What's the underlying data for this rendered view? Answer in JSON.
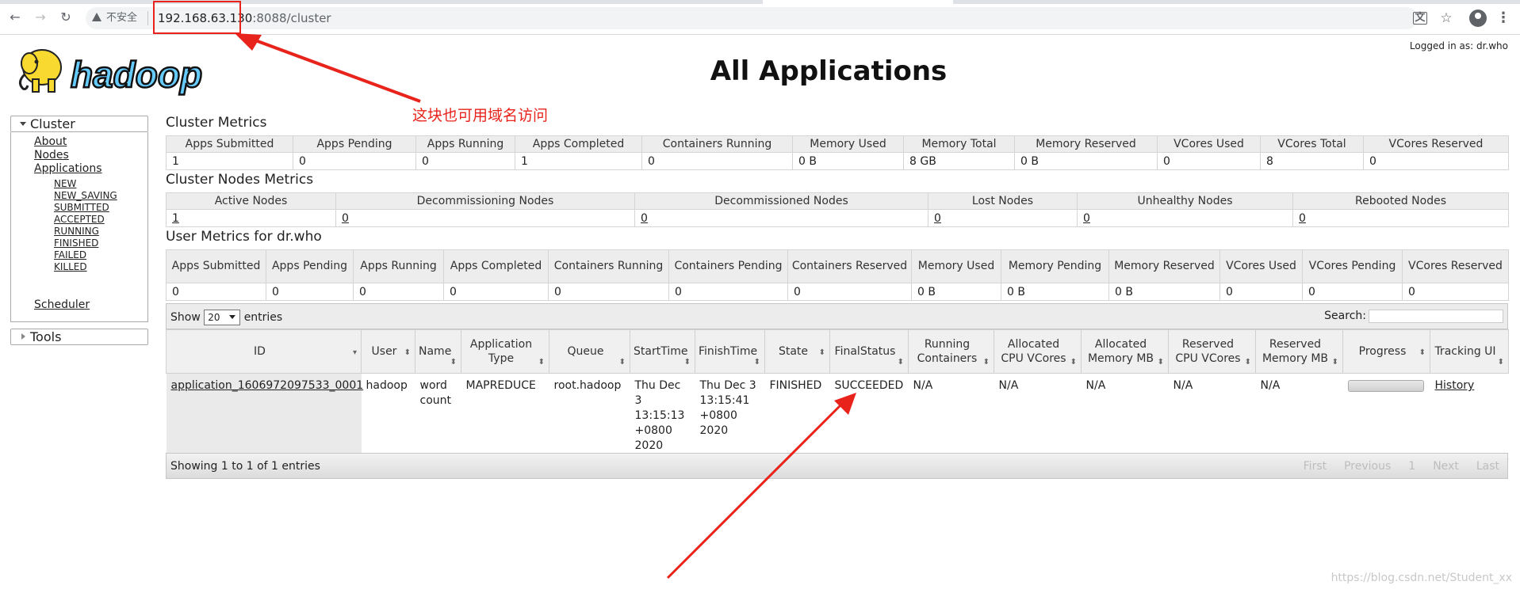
{
  "browser": {
    "security_label": "不安全",
    "url_host": "192.168.63.130",
    "url_rest": ":8088/cluster"
  },
  "header": {
    "logged_in": "Logged in as: dr.who",
    "title": "All Applications",
    "logo_text": "hadoop"
  },
  "annotation": "这块也可用域名访问",
  "nav": {
    "cluster_label": "Cluster",
    "about": "About",
    "nodes": "Nodes",
    "applications": "Applications",
    "app_states": [
      "NEW",
      "NEW_SAVING",
      "SUBMITTED",
      "ACCEPTED",
      "RUNNING",
      "FINISHED",
      "FAILED",
      "KILLED"
    ],
    "scheduler": "Scheduler",
    "tools_label": "Tools"
  },
  "cluster_metrics": {
    "title": "Cluster Metrics",
    "headers": [
      "Apps Submitted",
      "Apps Pending",
      "Apps Running",
      "Apps Completed",
      "Containers Running",
      "Memory Used",
      "Memory Total",
      "Memory Reserved",
      "VCores Used",
      "VCores Total",
      "VCores Reserved"
    ],
    "values": [
      "1",
      "0",
      "0",
      "1",
      "0",
      "0 B",
      "8 GB",
      "0 B",
      "0",
      "8",
      "0"
    ]
  },
  "node_metrics": {
    "title": "Cluster Nodes Metrics",
    "headers": [
      "Active Nodes",
      "Decommissioning Nodes",
      "Decommissioned Nodes",
      "Lost Nodes",
      "Unhealthy Nodes",
      "Rebooted Nodes"
    ],
    "values": [
      "1",
      "0",
      "0",
      "0",
      "0",
      "0"
    ]
  },
  "user_metrics": {
    "title": "User Metrics for dr.who",
    "headers": [
      "Apps Submitted",
      "Apps Pending",
      "Apps Running",
      "Apps Completed",
      "Containers Running",
      "Containers Pending",
      "Containers Reserved",
      "Memory Used",
      "Memory Pending",
      "Memory Reserved",
      "VCores Used",
      "VCores Pending",
      "VCores Reserved"
    ],
    "values": [
      "0",
      "0",
      "0",
      "0",
      "0",
      "0",
      "0",
      "0 B",
      "0 B",
      "0 B",
      "0",
      "0",
      "0"
    ]
  },
  "apps_table": {
    "show_label": "Show",
    "show_value": "20",
    "entries_label": "entries",
    "search_label": "Search:",
    "headers": [
      "ID",
      "User",
      "Name",
      "Application Type",
      "Queue",
      "StartTime",
      "FinishTime",
      "State",
      "FinalStatus",
      "Running Containers",
      "Allocated CPU VCores",
      "Allocated Memory MB",
      "Reserved CPU VCores",
      "Reserved Memory MB",
      "Progress",
      "Tracking UI"
    ],
    "row": {
      "id": "application_1606972097533_0001",
      "user": "hadoop",
      "name": "word count",
      "type": "MAPREDUCE",
      "queue": "root.hadoop",
      "start": "Thu Dec 3 13:15:13 +0800 2020",
      "finish": "Thu Dec 3 13:15:41 +0800 2020",
      "state": "FINISHED",
      "final_status": "SUCCEEDED",
      "running_containers": "N/A",
      "alloc_vcores": "N/A",
      "alloc_mem": "N/A",
      "res_vcores": "N/A",
      "res_mem": "N/A",
      "progress": 0,
      "tracking": "History"
    },
    "footer": "Showing 1 to 1 of 1 entries",
    "pager": [
      "First",
      "Previous",
      "1",
      "Next",
      "Last"
    ]
  },
  "watermark": "https://blog.csdn.net/Student_xx"
}
